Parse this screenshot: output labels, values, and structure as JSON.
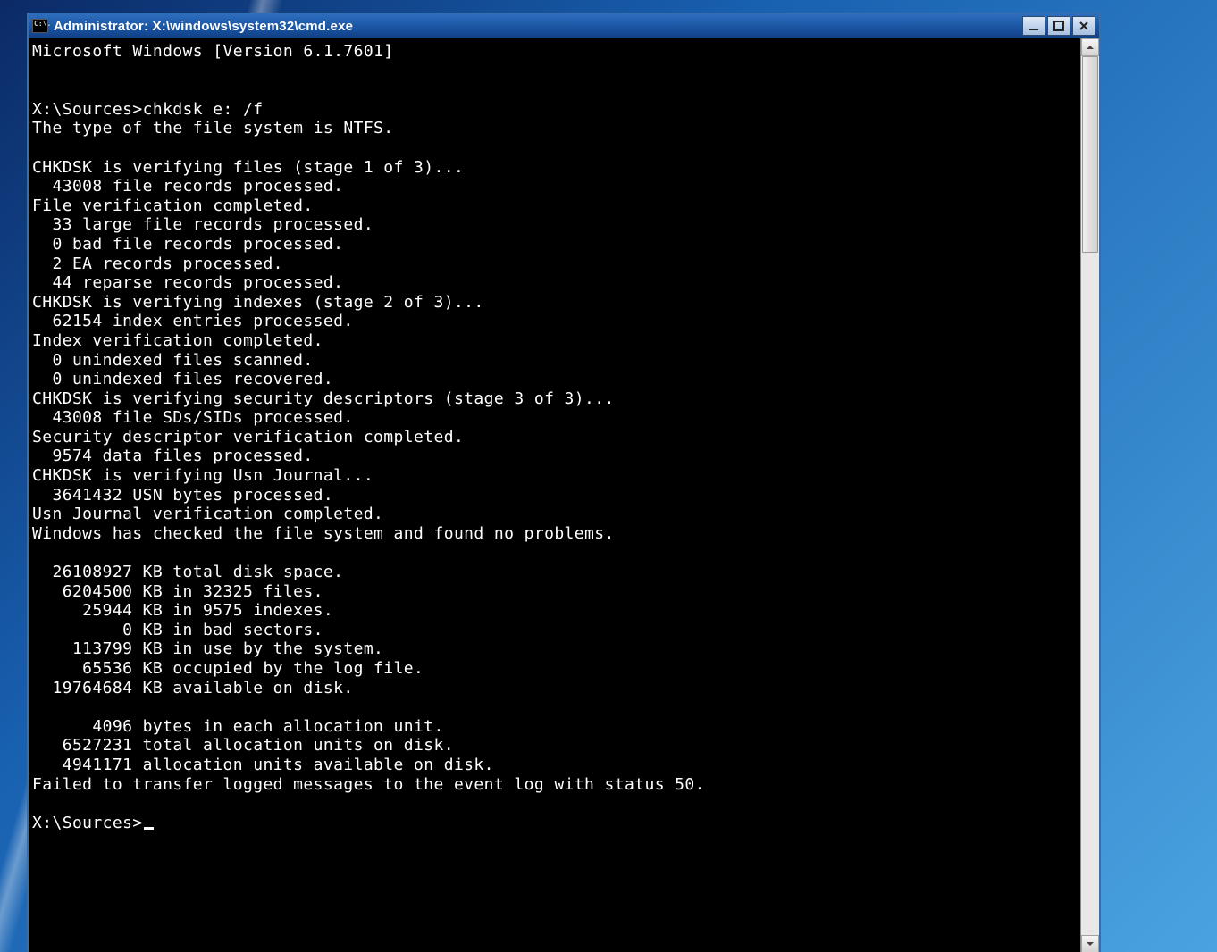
{
  "window": {
    "title": "Administrator: X:\\windows\\system32\\cmd.exe",
    "sysicon_text": "C:\\."
  },
  "terminal": {
    "lines": [
      "Microsoft Windows [Version 6.1.7601]",
      "",
      "",
      "X:\\Sources>chkdsk e: /f",
      "The type of the file system is NTFS.",
      "",
      "CHKDSK is verifying files (stage 1 of 3)...",
      "  43008 file records processed.",
      "File verification completed.",
      "  33 large file records processed.",
      "  0 bad file records processed.",
      "  2 EA records processed.",
      "  44 reparse records processed.",
      "CHKDSK is verifying indexes (stage 2 of 3)...",
      "  62154 index entries processed.",
      "Index verification completed.",
      "  0 unindexed files scanned.",
      "  0 unindexed files recovered.",
      "CHKDSK is verifying security descriptors (stage 3 of 3)...",
      "  43008 file SDs/SIDs processed.",
      "Security descriptor verification completed.",
      "  9574 data files processed.",
      "CHKDSK is verifying Usn Journal...",
      "  3641432 USN bytes processed.",
      "Usn Journal verification completed.",
      "Windows has checked the file system and found no problems.",
      "",
      "  26108927 KB total disk space.",
      "   6204500 KB in 32325 files.",
      "     25944 KB in 9575 indexes.",
      "         0 KB in bad sectors.",
      "    113799 KB in use by the system.",
      "     65536 KB occupied by the log file.",
      "  19764684 KB available on disk.",
      "",
      "      4096 bytes in each allocation unit.",
      "   6527231 total allocation units on disk.",
      "   4941171 allocation units available on disk.",
      "Failed to transfer logged messages to the event log with status 50.",
      ""
    ],
    "prompt": "X:\\Sources>"
  }
}
